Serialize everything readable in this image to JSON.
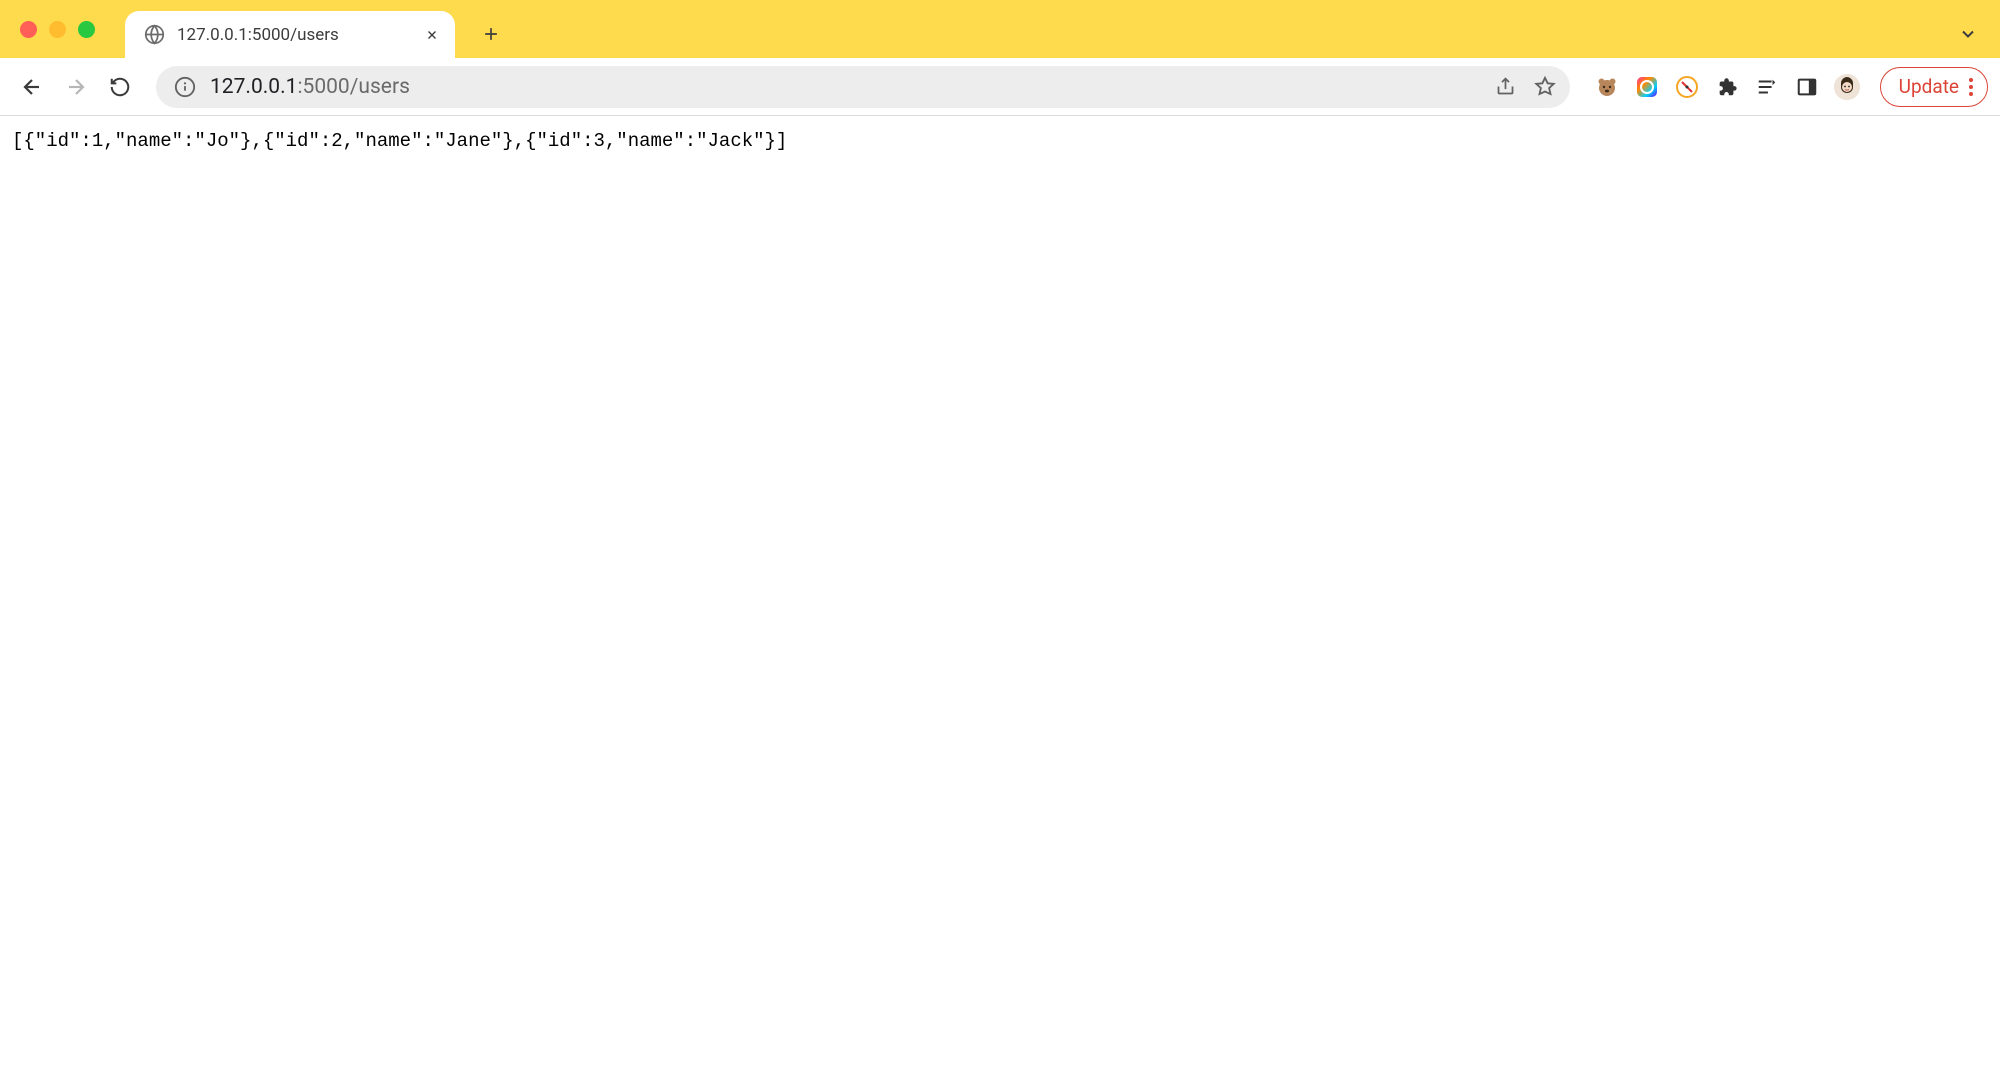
{
  "window": {
    "tabs": [
      {
        "title": "127.0.0.1:5000/users"
      }
    ]
  },
  "toolbar": {
    "url_host": "127.0.0.1",
    "url_path": ":5000/users",
    "update_label": "Update"
  },
  "page": {
    "body_text": "[{\"id\":1,\"name\":\"Jo\"},{\"id\":2,\"name\":\"Jane\"},{\"id\":3,\"name\":\"Jack\"}]"
  },
  "response_data": [
    {
      "id": 1,
      "name": "Jo"
    },
    {
      "id": 2,
      "name": "Jane"
    },
    {
      "id": 3,
      "name": "Jack"
    }
  ],
  "colors": {
    "theme": "#fedb4d",
    "update_accent": "#db4437"
  }
}
